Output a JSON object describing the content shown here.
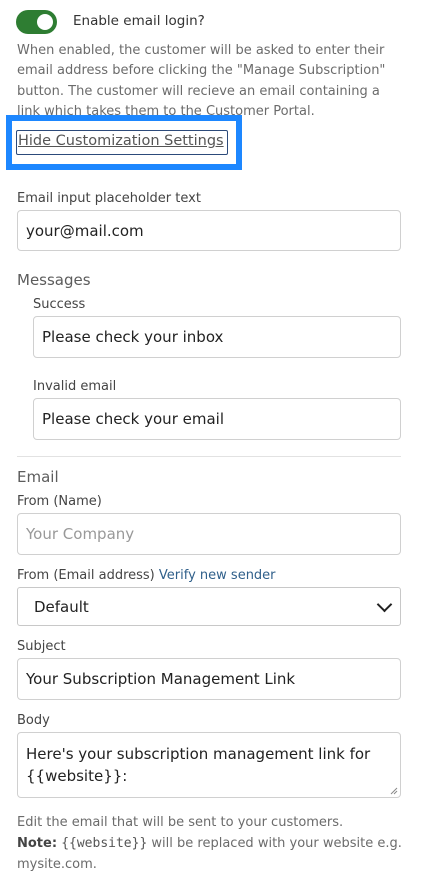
{
  "email_login": {
    "toggle_on": true,
    "label": "Enable email login?",
    "help": "When enabled, the customer will be asked to enter their email address before clicking the \"Manage Subscription\" button. The customer will recieve an email containing a link which takes them to the Customer Portal."
  },
  "customization_link": "Hide Customization Settings",
  "placeholder_field": {
    "label": "Email input placeholder text",
    "value": "your@mail.com"
  },
  "messages": {
    "title": "Messages",
    "success": {
      "label": "Success",
      "value": "Please check your inbox"
    },
    "invalid": {
      "label": "Invalid email",
      "value": "Please check your email"
    }
  },
  "email": {
    "title": "Email",
    "from_name": {
      "label": "From (Name)",
      "placeholder": "Your Company"
    },
    "from_address": {
      "label": "From (Email address)",
      "link": "Verify new sender",
      "selected": "Default"
    },
    "subject": {
      "label": "Subject",
      "value": "Your Subscription Management Link"
    },
    "body": {
      "label": "Body",
      "value": "Here's your subscription management link for {{website}}:"
    },
    "note": {
      "line1": "Edit the email that will be sent to your customers.",
      "bold": "Note:",
      "code": "{{website}}",
      "rest": "will be replaced with your website e.g. mysite.com."
    }
  },
  "colors": {
    "toggle": "#2e7d32",
    "highlight": "#1d87ff",
    "link": "#2f5f8a"
  }
}
